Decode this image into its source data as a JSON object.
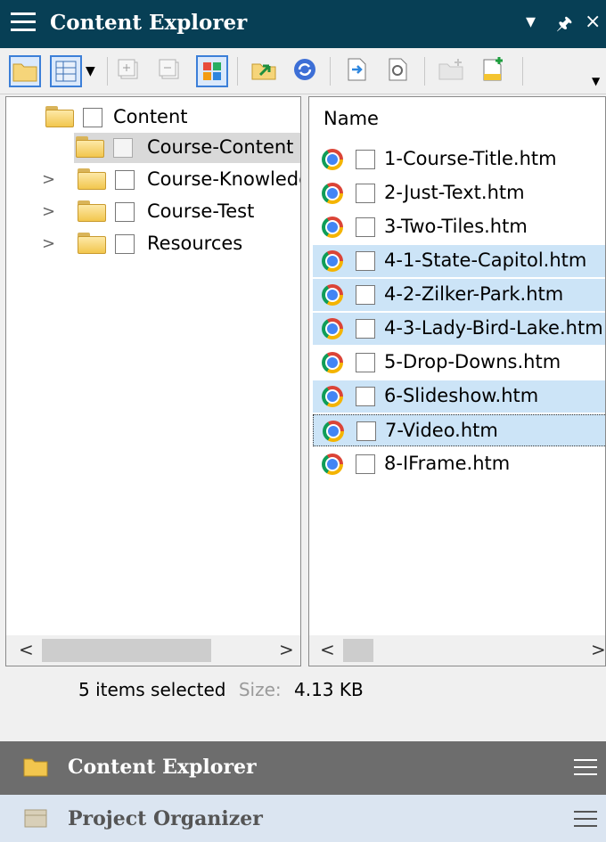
{
  "window": {
    "title": "Content Explorer",
    "pin_glyph": "▾",
    "pin2_glyph": "❙",
    "close_glyph": "×"
  },
  "toolbar": {
    "icons": [
      "open-folder-icon",
      "view-table-icon",
      "dropdown-arrow-icon",
      "expand-icon",
      "collapse-icon",
      "thumbnails-icon",
      "import-icon",
      "refresh-icon",
      "open-file-icon",
      "properties-icon",
      "new-folder-icon",
      "new-file-icon",
      "overflow-icon"
    ]
  },
  "tree": {
    "items": [
      {
        "label": "Content"
      },
      {
        "label": "Course-Content"
      },
      {
        "label": "Course-Knowledge"
      },
      {
        "label": "Course-Test"
      },
      {
        "label": "Resources"
      }
    ],
    "expand_glyph": ">"
  },
  "files": {
    "column_name": "Name",
    "items": [
      {
        "label": "1-Course-Title.htm",
        "selected": false
      },
      {
        "label": "2-Just-Text.htm",
        "selected": false
      },
      {
        "label": "3-Two-Tiles.htm",
        "selected": false
      },
      {
        "label": "4-1-State-Capitol.htm",
        "selected": true
      },
      {
        "label": "4-2-Zilker-Park.htm",
        "selected": true
      },
      {
        "label": "4-3-Lady-Bird-Lake.htm",
        "selected": true
      },
      {
        "label": "5-Drop-Downs.htm",
        "selected": false
      },
      {
        "label": "6-Slideshow.htm",
        "selected": true
      },
      {
        "label": "7-Video.htm",
        "selected": true
      },
      {
        "label": "8-IFrame.htm",
        "selected": false
      }
    ]
  },
  "scroll": {
    "left": "<",
    "right": ">"
  },
  "status": {
    "selected_text": "5 items selected",
    "size_label": "Size:",
    "size_value": "4.13 KB"
  },
  "panels": [
    {
      "label": "Content Explorer",
      "active": true
    },
    {
      "label": "Project Organizer",
      "active": false
    }
  ],
  "colors": {
    "title_bar": "#073f55",
    "selection": "#cce4f7",
    "active_panel": "#6d6d6d",
    "inactive_panel": "#dbe5f1"
  }
}
